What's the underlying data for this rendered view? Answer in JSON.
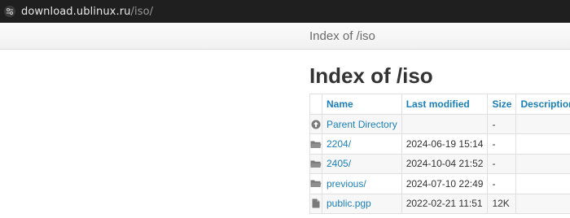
{
  "browser": {
    "url_host": "download.ublinux.ru",
    "url_path": "/iso/"
  },
  "topbar": {
    "title": "Index of /iso"
  },
  "page": {
    "heading": "Index of /iso"
  },
  "table": {
    "headers": {
      "name": "Name",
      "modified": "Last modified",
      "size": "Size",
      "description": "Description"
    },
    "rows": [
      {
        "icon": "parent-dir-icon",
        "name": "Parent Directory",
        "modified": "",
        "size": "-",
        "description": ""
      },
      {
        "icon": "folder-icon",
        "name": "2204/",
        "modified": "2024-06-19 15:14",
        "size": "-",
        "description": ""
      },
      {
        "icon": "folder-icon",
        "name": "2405/",
        "modified": "2024-10-04 21:52",
        "size": "-",
        "description": ""
      },
      {
        "icon": "folder-icon",
        "name": "previous/",
        "modified": "2024-07-10 22:49",
        "size": "-",
        "description": ""
      },
      {
        "icon": "file-icon",
        "name": "public.pgp",
        "modified": "2022-02-21 11:51",
        "size": "12K",
        "description": ""
      }
    ]
  }
}
